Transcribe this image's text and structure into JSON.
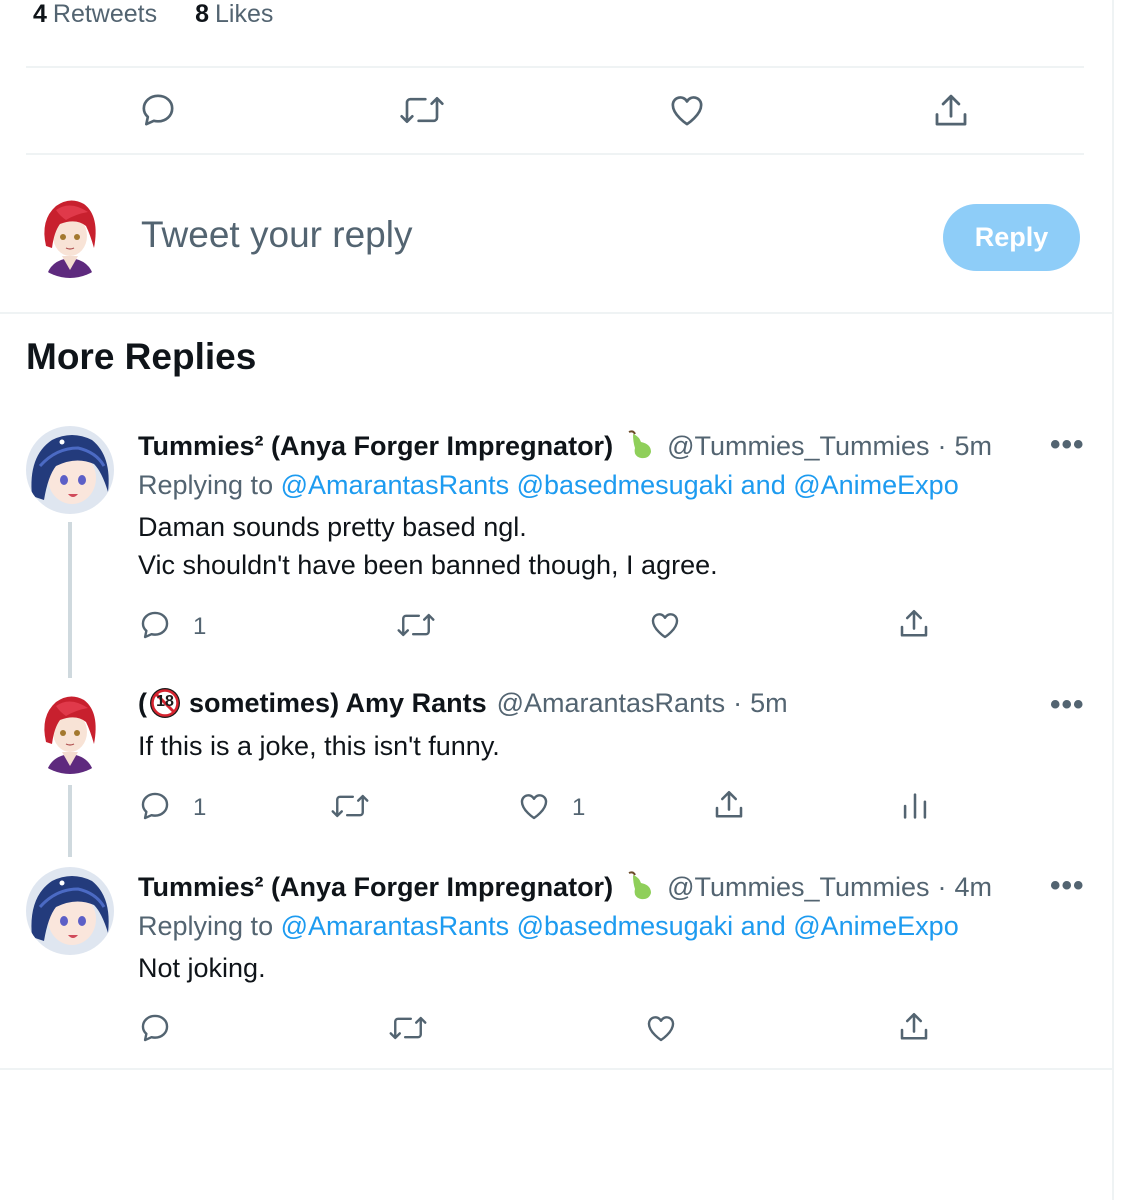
{
  "stats": {
    "retweets_count": "4",
    "retweets_label": "Retweets",
    "likes_count": "8",
    "likes_label": "Likes"
  },
  "compose": {
    "placeholder": "Tweet your reply",
    "reply_button": "Reply"
  },
  "section_title": "More Replies",
  "tweets": [
    {
      "name": "Tummies² (Anya Forger Impregnator)",
      "emoji": "pear",
      "handle": "@Tummies_Tummies",
      "dot": "·",
      "time": "5m",
      "replying_prefix": "Replying to",
      "replying_to": "@AmarantasRants @basedmesugaki",
      "replying_and": "and",
      "replying_last": "@AnimeExpo",
      "body_line1": "Daman sounds pretty based ngl.",
      "body_line2": "Vic shouldn't have been banned though, I agree.",
      "reply_count": "1",
      "more": "•••"
    },
    {
      "name_prefix": "(",
      "badge": "18",
      "name": "sometimes) Amy Rants",
      "handle": "@AmarantasRants",
      "dot": "·",
      "time": "5m",
      "body_line1": "If this is a joke, this isn't funny.",
      "reply_count": "1",
      "like_count": "1",
      "more": "•••"
    },
    {
      "name": "Tummies² (Anya Forger Impregnator)",
      "emoji": "pear",
      "handle": "@Tummies_Tummies",
      "dot": "·",
      "time": "4m",
      "replying_prefix": "Replying to",
      "replying_to": "@AmarantasRants @basedmesugaki",
      "replying_and": "and",
      "replying_last": "@AnimeExpo",
      "body_line1": "Not joking.",
      "more": "•••"
    }
  ],
  "colors": {
    "accent": "#1d9bf0",
    "reply_button_disabled": "#8ecdf8",
    "secondary_text": "#536471",
    "divider": "#eff3f4"
  }
}
